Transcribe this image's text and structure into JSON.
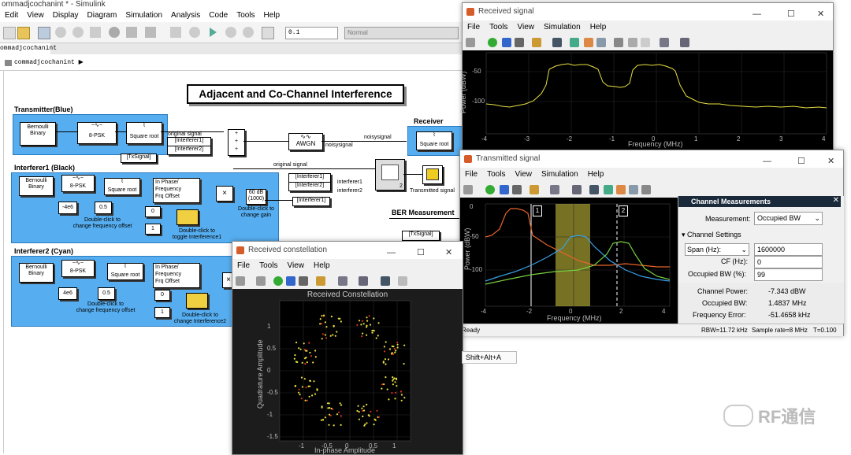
{
  "main_window": {
    "title": "ommadjcochanint * - Simulink",
    "menu": [
      "Edit",
      "View",
      "Display",
      "Diagram",
      "Simulation",
      "Analysis",
      "Code",
      "Tools",
      "Help"
    ],
    "stop_time": "0.1",
    "sim_mode": "Normal",
    "tab": "ommadjcochanint",
    "breadcrumb": "commadjcochanint"
  },
  "model": {
    "title": "Adjacent and Co-Channel Interference",
    "transmitter": {
      "label": "Transmitter(Blue)",
      "bernoulli": "Bernoulli\nBinary",
      "psk": "8-PSK",
      "sqrt": "Square root"
    },
    "interferer1": {
      "label": "Interferer1 (Black)",
      "bernoulli": "Bernoulli\nBinary",
      "psk": "8-PSK",
      "sqrt": "Square root",
      "phase": "In  Phase/\nFrequency\nFrq  Offset",
      "freq": "-4e6",
      "gainc": "0.5",
      "note_freq": "Double-click to\nchange frequency offset",
      "sw0": "0",
      "sw1": "1",
      "note_toggle": "Double-click to\ntoggle Interference1",
      "gain": "60 dB\n(1000)",
      "note_gain": "Double-click to\nchange gain",
      "tag": "[Interferer1]"
    },
    "interferer2": {
      "label": "Interferer2 (Cyan)",
      "bernoulli": "Bernoulli\nBinary",
      "psk": "8-PSK",
      "sqrt": "Square root",
      "phase": "In  Phase/\nFrequency\nFrq  Offset",
      "freq": "4e6",
      "gainc": "0.5",
      "note_freq": "Double-click to\nchange frequency offset",
      "sw0": "0",
      "sw1": "1",
      "note_toggle": "Double-click to\nchange Interference2"
    },
    "tags": {
      "txsignal": "[TxSignal]",
      "interf1": "[Interferer1]",
      "interf2": "[Interferer2]"
    },
    "labels": {
      "original_signal_top": "original signal",
      "noisysignal": "noisysignal",
      "noisysignal2": "noisysignal",
      "original_signal": "original signal",
      "interferer1": "interferer1",
      "interferer2": "interferer2",
      "transmitted_signal": "Transmitted signal",
      "receiver": "Receiver",
      "rx_sqrt": "Square root",
      "ber": "BER Measurement",
      "awgn": "AWGN",
      "sel_num": "2",
      "ber_tx": "[TxSignal]"
    }
  },
  "received_signal": {
    "title": "Received signal",
    "menu": [
      "File",
      "Tools",
      "View",
      "Simulation",
      "Help"
    ],
    "ylabel": "Power (dBW)",
    "xlabel": "Frequency (MHz)",
    "yticks": [
      "-50",
      "-100"
    ],
    "xticks": [
      "-4",
      "-3",
      "-2",
      "-1",
      "0",
      "1",
      "2",
      "3",
      "4"
    ]
  },
  "transmitted_signal": {
    "title": "Transmitted signal",
    "menu": [
      "File",
      "Tools",
      "View",
      "Simulation",
      "Help"
    ],
    "ylabel": "Power (dBW)",
    "xlabel": "Frequency (MHz)",
    "yticks": [
      "0",
      "-50",
      "-100"
    ],
    "xticks": [
      "-4",
      "-2",
      "0",
      "2",
      "4"
    ],
    "cursor1": "1",
    "cursor2": "2",
    "panel": {
      "title": "Channel Measurements",
      "measurement_label": "Measurement:",
      "measurement_value": "Occupied BW",
      "section": "Channel Settings",
      "span_label": "Span (Hz):",
      "span_value": "1600000",
      "cf_label": "CF (Hz):",
      "cf_value": "0",
      "obw_label": "Occupied BW (%):",
      "obw_value": "99",
      "ch_power_label": "Channel Power:",
      "ch_power_value": "-7.343  dBW",
      "occ_bw_label": "Occupied BW:",
      "occ_bw_value": "1.4837 MHz",
      "freq_err_label": "Frequency Error:",
      "freq_err_value": "-51.4658 kHz"
    },
    "status_ready": "Ready",
    "status_rbw": "RBW=11.72 kHz",
    "status_rate": "Sample rate=8 MHz",
    "status_t": "T=0.100"
  },
  "received_constellation": {
    "title": "Received constellation",
    "menu": [
      "File",
      "Tools",
      "View",
      "Help"
    ],
    "plot_title": "Received Constellation",
    "xlabel": "In-phase Amplitude",
    "ylabel": "Quadrature Amplitude",
    "yticks": [
      "1",
      "0.5",
      "0",
      "-0.5",
      "-1",
      "-1.5"
    ],
    "xticks": [
      "-1",
      "-0.5",
      "0",
      "0.5",
      "1"
    ]
  },
  "shortcut_hint": "Shift+Alt+A",
  "watermark": "RF通信",
  "colors": {
    "group_blue": "#56aef0",
    "trace_yellow": "#e8e040",
    "trace_orange": "#e8652a",
    "trace_blue": "#3a9fe8",
    "trace_green": "#78d040",
    "marker_red": "#e03020"
  }
}
